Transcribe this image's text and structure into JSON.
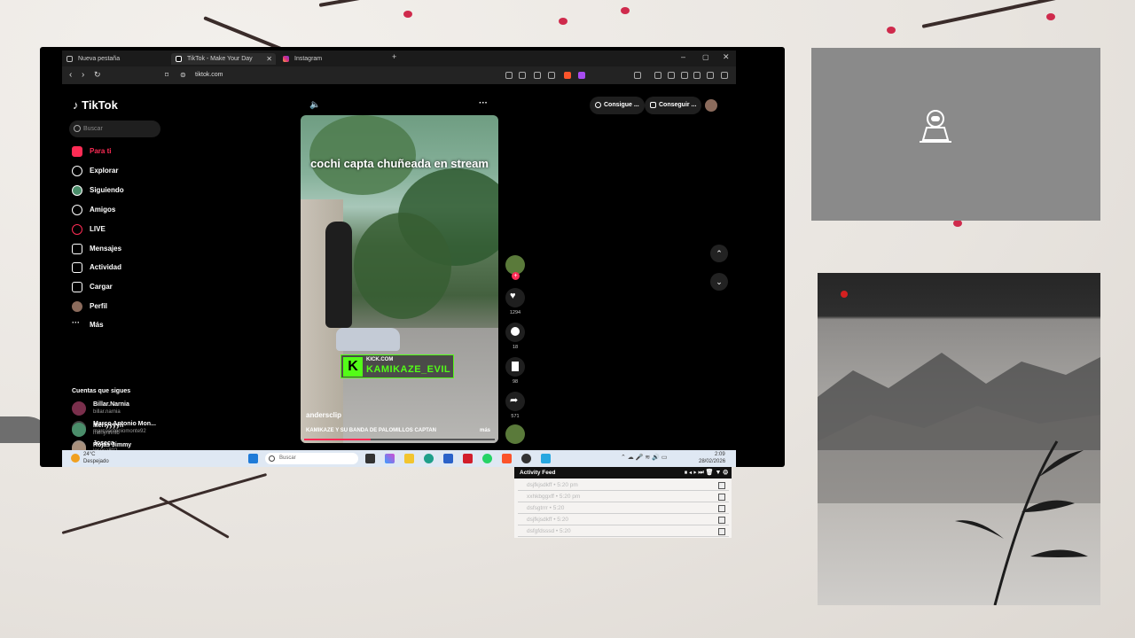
{
  "browser": {
    "tabs": [
      {
        "label": "Nueva pestaña"
      },
      {
        "label": "TikTok - Make Your Day"
      },
      {
        "label": "Instagram"
      }
    ],
    "url": "tiktok.com"
  },
  "tiktok": {
    "logo": "TikTok",
    "search_placeholder": "Buscar",
    "nav": [
      {
        "label": "Para ti",
        "icon": "home-icon"
      },
      {
        "label": "Explorar",
        "icon": "compass-icon"
      },
      {
        "label": "Siguiendo",
        "icon": "following-icon"
      },
      {
        "label": "Amigos",
        "icon": "friends-icon"
      },
      {
        "label": "LIVE",
        "icon": "live-icon"
      },
      {
        "label": "Mensajes",
        "icon": "messages-icon"
      },
      {
        "label": "Actividad",
        "icon": "activity-icon"
      },
      {
        "label": "Cargar",
        "icon": "upload-icon"
      },
      {
        "label": "Perfil",
        "icon": "profile-icon"
      },
      {
        "label": "Más",
        "icon": "more-icon"
      }
    ],
    "following_header": "Cuentas que sigues",
    "following": [
      {
        "name": "Billar.Narnia",
        "handle": "billar.narnia"
      },
      {
        "name": "Marco Antonio Mon...",
        "handle": "marcoantoniomonte92"
      },
      {
        "name": "Joseca",
        "handle": "joseca802"
      },
      {
        "name": "Merlyyyyn",
        "handle": "merlynnnfb"
      },
      {
        "name": "Rojas Jimmy",
        "handle": ""
      }
    ],
    "top_buttons": [
      "Consigue ...",
      "Conseguir ..."
    ],
    "video": {
      "caption": "cochi capta chuñeada en stream",
      "overlay_small": "KICK.COM",
      "overlay_large": "KAMIKAZE_EVIL",
      "author": "andersclip",
      "description": "KAMIKAZE Y SU BANDA DE PALOMILLOS CAPTAN",
      "more": "más",
      "progress": 0.35
    },
    "counts": {
      "likes": "1294",
      "comments": "18",
      "saves": "98",
      "shares": "571"
    }
  },
  "taskbar": {
    "weather_temp": "24°C",
    "weather_desc": "Despejado",
    "search_placeholder": "Buscar",
    "time": "2:09",
    "date": "28/02/2026"
  },
  "activity_feed": {
    "title": "Activity Feed",
    "rows": [
      "dsjfkjsdkff • 5:20 pm",
      "xxhkbggxff • 5:20 pm",
      "dsfsgtrrr • 5:20",
      "dsjfkjsdkff • 5:20",
      "dsfgfdsssd • 5:20"
    ]
  },
  "colors": {
    "accent": "#fe2c55",
    "kick_green": "#53fc18"
  }
}
